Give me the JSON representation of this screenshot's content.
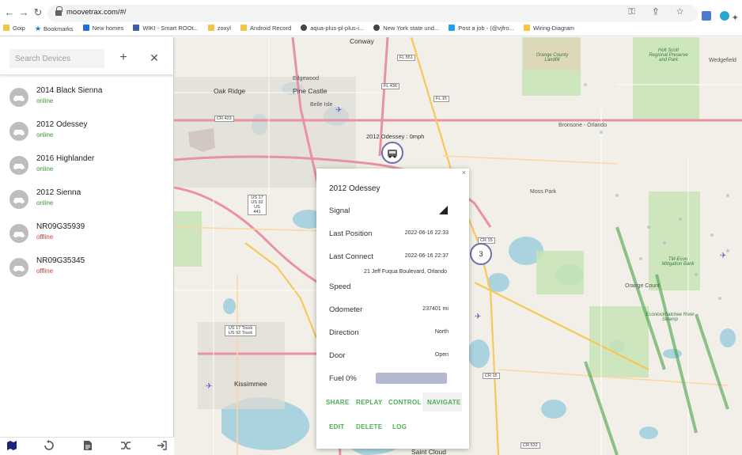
{
  "browser": {
    "url": "moovetrax.com/#/",
    "bookmarks": [
      "Goip",
      "Bookmarks",
      "New homes",
      "WIKI - Smart ROOt...",
      "zoxyl",
      "Android Record",
      "aqua-plus-pl-plus-i...",
      "New York state und...",
      "Post a job - (@vjfro...",
      "Wiring-Diagram"
    ]
  },
  "sidebar": {
    "search_placeholder": "Search Devices",
    "devices": [
      {
        "name": "2014 Black Sienna",
        "status": "online"
      },
      {
        "name": "2012 Odessey",
        "status": "online"
      },
      {
        "name": "2016 Highlander",
        "status": "online"
      },
      {
        "name": "2012 Sienna",
        "status": "online"
      },
      {
        "name": "NR09G35939",
        "status": "offline"
      },
      {
        "name": "NR09G35345",
        "status": "offline"
      }
    ],
    "status_colors": {
      "online": "#2e9e2e",
      "offline": "#e53935"
    }
  },
  "map": {
    "labels": [
      "Conway",
      "Oak Ridge",
      "Pine Castle",
      "Edgewood",
      "Belle Isle",
      "Kissimmee",
      "Saint Cloud",
      "Orange County Landfill",
      "Holt Scott Regional Preserve and Park",
      "Wedgefield",
      "TM-Econ Mitigation Bank",
      "Econlockhatchee River Swamp",
      "Orange Count",
      "Moss Park",
      "Bronsone - Orlando"
    ],
    "roads": [
      "FL 551",
      "FL 436",
      "FL 15",
      "CR 423",
      "US 17 US 92 US 441",
      "CR 15",
      "US 17 Truck US 92 Truck",
      "CR 15",
      "CR 532"
    ],
    "vehicle_label": "2012 Odessey : 0mph",
    "cluster_count": "3"
  },
  "popup": {
    "close": "×",
    "title": "2012 Odessey",
    "rows": [
      {
        "label": "Signal",
        "value": ""
      },
      {
        "label": "Last Position",
        "value": "2022-06-16 22:33"
      },
      {
        "label": "Last Connect",
        "value": "2022-06-16 22:37"
      },
      {
        "label": "Speed",
        "value": ""
      },
      {
        "label": "Odometer",
        "value": "237401 mi"
      },
      {
        "label": "Direction",
        "value": "North"
      },
      {
        "label": "Door",
        "value": "Open"
      }
    ],
    "address": "21 Jeff Fuqua Boulevard, Orlando",
    "fuel_label": "Fuel 0%",
    "fuel_level": 0,
    "actions": [
      "SHARE",
      "REPLAY",
      "CONTROL",
      "NAVIGATE",
      "EDIT",
      "DELETE",
      "LOG"
    ],
    "accent": "#4caf50"
  }
}
